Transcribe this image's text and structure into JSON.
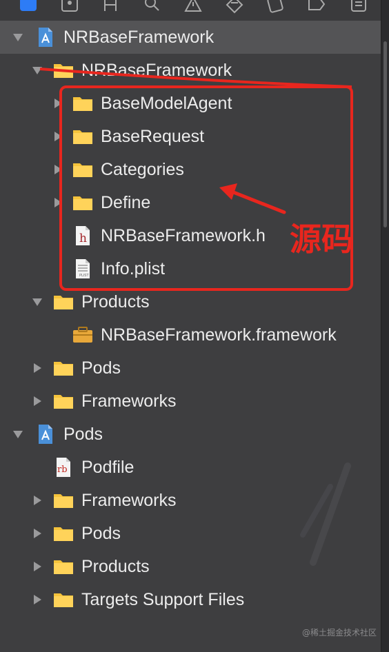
{
  "toolbar": {
    "icons": [
      "project-navigator-icon",
      "source-control-icon",
      "symbol-navigator-icon",
      "find-icon",
      "issue-warning-icon",
      "test-diamond-icon",
      "debug-icon",
      "breakpoint-icon",
      "report-icon"
    ]
  },
  "tree": {
    "rows": [
      {
        "label": "NRBaseFramework",
        "kind": "project",
        "expanded": true,
        "selected": true
      },
      {
        "label": "NRBaseFramework",
        "kind": "folder",
        "expanded": true
      },
      {
        "label": "BaseModelAgent",
        "kind": "folder",
        "expanded": false
      },
      {
        "label": "BaseRequest",
        "kind": "folder",
        "expanded": false
      },
      {
        "label": "Categories",
        "kind": "folder",
        "expanded": false
      },
      {
        "label": "Define",
        "kind": "folder",
        "expanded": false
      },
      {
        "label": "NRBaseFramework.h",
        "kind": "header"
      },
      {
        "label": "Info.plist",
        "kind": "plist"
      },
      {
        "label": "Products",
        "kind": "folder",
        "expanded": true
      },
      {
        "label": "NRBaseFramework.framework",
        "kind": "framework"
      },
      {
        "label": "Pods",
        "kind": "folder",
        "expanded": false
      },
      {
        "label": "Frameworks",
        "kind": "folder",
        "expanded": false
      },
      {
        "label": "Pods",
        "kind": "project",
        "expanded": true
      },
      {
        "label": "Podfile",
        "kind": "ruby"
      },
      {
        "label": "Frameworks",
        "kind": "folder",
        "expanded": false
      },
      {
        "label": "Pods",
        "kind": "folder",
        "expanded": false
      },
      {
        "label": "Products",
        "kind": "folder",
        "expanded": false
      },
      {
        "label": "Targets Support Files",
        "kind": "folder",
        "expanded": false
      }
    ]
  },
  "annotation": {
    "text": "源码",
    "color": "#e8261e"
  },
  "watermark": "@稀土掘金技术社区",
  "colors": {
    "background": "#3e3e40",
    "selection": "#545456",
    "folder": "#f5c33b",
    "project_icon": "#4a90d9",
    "annotation": "#e8261e"
  }
}
